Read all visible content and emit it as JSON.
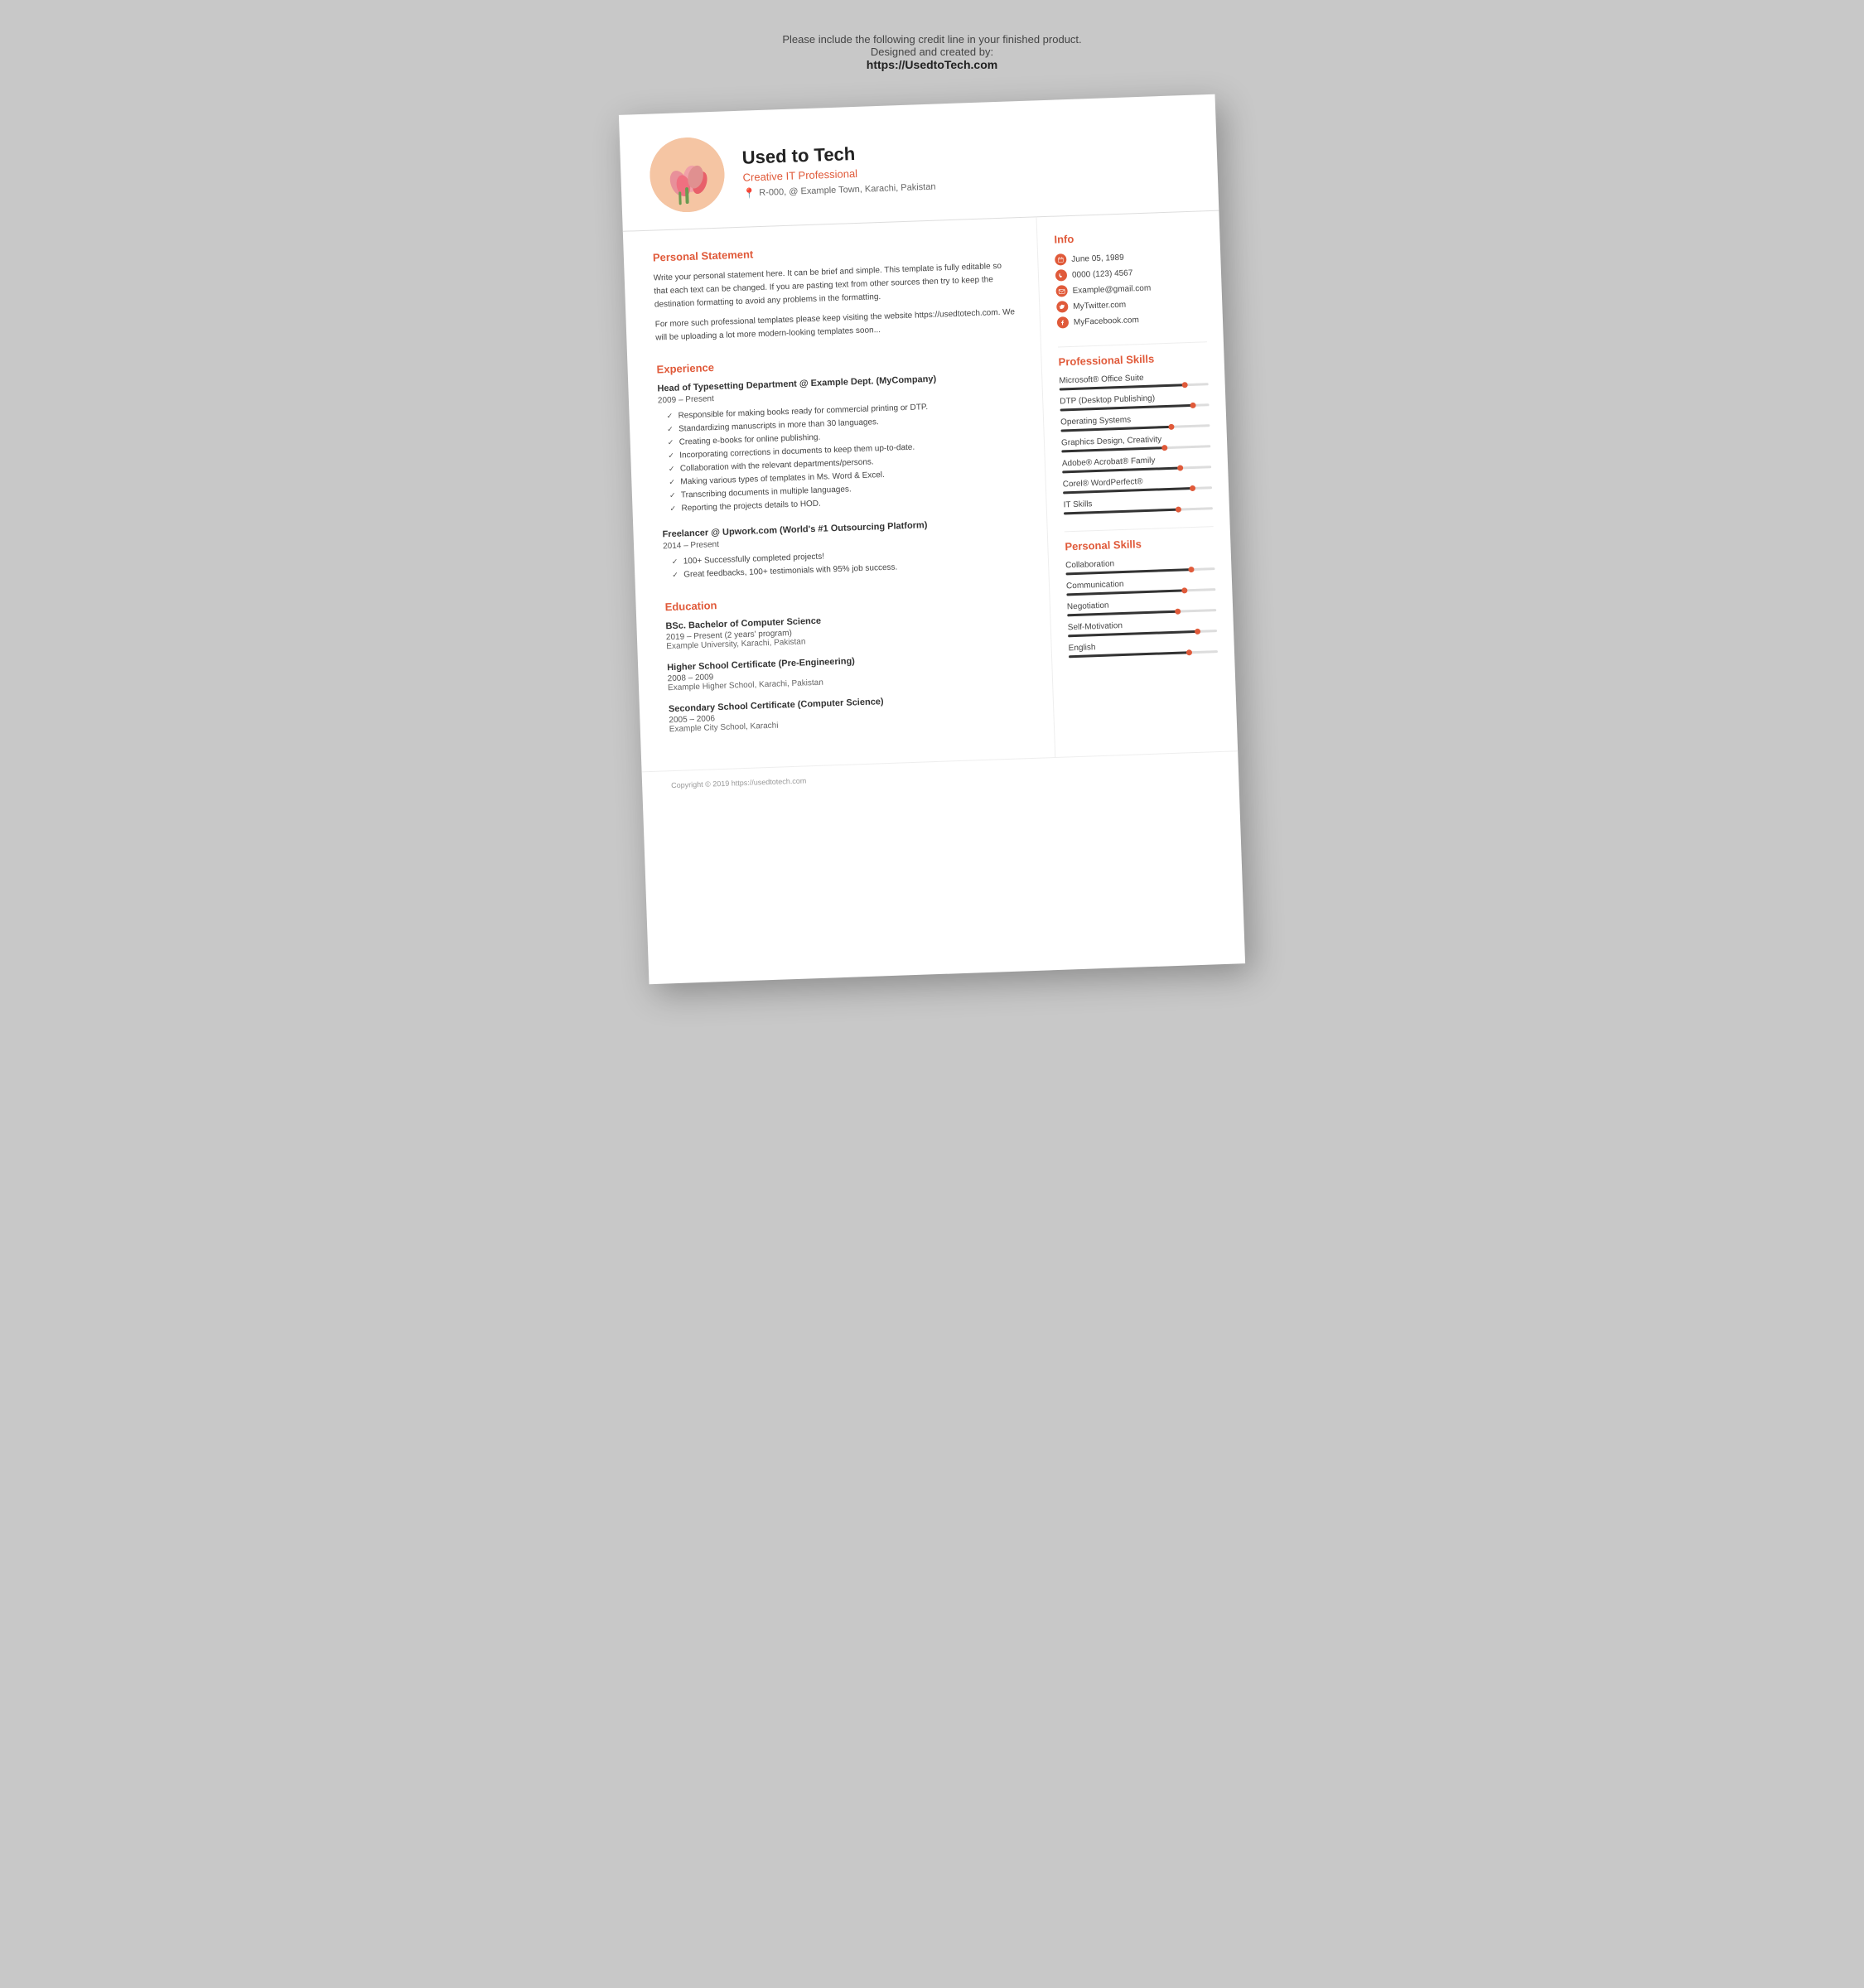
{
  "credit": {
    "line1": "Please include the following credit line in your finished product.",
    "line2": "Designed and created by:",
    "link": "https://UsedtoTech.com"
  },
  "header": {
    "name": "Used to Tech",
    "subtitle": "Creative IT Professional",
    "address": "R-000, @ Example Town, Karachi, Pakistan"
  },
  "personal_statement": {
    "title": "Personal Statement",
    "para1": "Write your personal statement here. It can be brief and simple. This template is fully editable so that each text can be changed. If you are pasting text from other sources then try to keep the destination formatting to avoid any problems in the formatting.",
    "para2": "For more such professional templates please keep visiting the website https://usedtotech.com. We will be uploading a lot more modern-looking templates soon..."
  },
  "experience": {
    "title": "Experience",
    "jobs": [
      {
        "title": "Head of Typesetting Department @ Example Dept. (MyCompany)",
        "dates": "2009 – Present",
        "duties": [
          "Responsible for making books ready for commercial printing or DTP.",
          "Standardizing manuscripts in more than 30 languages.",
          "Creating e-books for online publishing.",
          "Incorporating corrections in documents to keep them up-to-date.",
          "Collaboration with the relevant departments/persons.",
          "Making various types of templates in Ms. Word & Excel.",
          "Transcribing documents in multiple languages.",
          "Reporting the projects details to HOD."
        ]
      },
      {
        "title": "Freelancer @ Upwork.com (World's #1 Outsourcing Platform)",
        "dates": "2014 – Present",
        "duties": [
          "100+ Successfully completed projects!",
          "Great feedbacks, 100+ testimonials with 95% job success."
        ]
      }
    ]
  },
  "education": {
    "title": "Education",
    "items": [
      {
        "degree": "BSc. Bachelor of Computer Science",
        "dates": "2019 – Present (2 years' program)",
        "school": "Example University, Karachi, Pakistan"
      },
      {
        "degree": "Higher School Certificate (Pre-Engineering)",
        "dates": "2008 – 2009",
        "school": "Example Higher School, Karachi, Pakistan"
      },
      {
        "degree": "Secondary School Certificate (Computer Science)",
        "dates": "2005 – 2006",
        "school": "Example City School, Karachi"
      }
    ]
  },
  "info": {
    "title": "Info",
    "items": [
      {
        "icon": "calendar",
        "text": "June 05, 1989"
      },
      {
        "icon": "phone",
        "text": "0000 (123) 4567"
      },
      {
        "icon": "email",
        "text": "Example@gmail.com"
      },
      {
        "icon": "twitter",
        "text": "MyTwitter.com"
      },
      {
        "icon": "facebook",
        "text": "MyFacebook.com"
      }
    ]
  },
  "professional_skills": {
    "title": "Professional Skills",
    "items": [
      {
        "name": "Microsoft® Office Suite",
        "percent": 85
      },
      {
        "name": "DTP (Desktop Publishing)",
        "percent": 90
      },
      {
        "name": "Operating Systems",
        "percent": 75
      },
      {
        "name": "Graphics Design, Creativity",
        "percent": 70
      },
      {
        "name": "Adobe® Acrobat® Family",
        "percent": 80
      },
      {
        "name": "Corel® WordPerfect®",
        "percent": 88
      },
      {
        "name": "IT Skills",
        "percent": 78
      }
    ]
  },
  "personal_skills": {
    "title": "Personal Skills",
    "items": [
      {
        "name": "Collaboration",
        "percent": 85
      },
      {
        "name": "Communication",
        "percent": 80
      },
      {
        "name": "Negotiation",
        "percent": 75
      },
      {
        "name": "Self-Motivation",
        "percent": 88
      },
      {
        "name": "English",
        "percent": 82
      }
    ]
  },
  "footer": {
    "text": "Copyright © 2019 https://usedtotech.com"
  }
}
